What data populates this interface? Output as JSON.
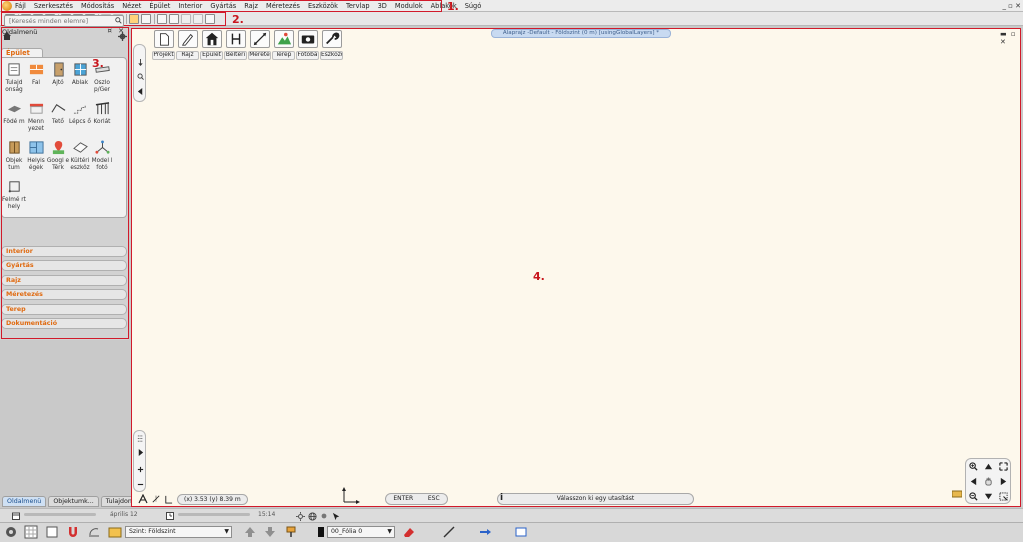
{
  "menu": {
    "items": [
      "Fájl",
      "Szerkesztés",
      "Módosítás",
      "Nézet",
      "Épület",
      "Interior",
      "Gyártás",
      "Rajz",
      "Méretezés",
      "Eszközök",
      "Tervlap",
      "3D",
      "Modulok",
      "Ablakok",
      "Súgó"
    ],
    "window_controls": "_ ▫ ✕"
  },
  "markers": {
    "m1": "1.",
    "m2": "2.",
    "m3": "3.",
    "m4": "4."
  },
  "left_panel": {
    "title": "Oldalmenü",
    "controls": "¤ ✕",
    "search_placeholder": "[Keresés minden elemre]",
    "active_category": "Épület",
    "tools": [
      {
        "label": "Tulajd onság"
      },
      {
        "label": "Fal"
      },
      {
        "label": "Ajtó"
      },
      {
        "label": "Ablak"
      },
      {
        "label": "Oszlo p/Ger"
      },
      {
        "label": "Födé m"
      },
      {
        "label": "Menn yezet"
      },
      {
        "label": "Tető"
      },
      {
        "label": "Lépcs ő"
      },
      {
        "label": "Korlát"
      },
      {
        "label": "Objek tum"
      },
      {
        "label": "Helyis égek"
      },
      {
        "label": "Googl e Térk"
      },
      {
        "label": "Kültéri eszköz"
      },
      {
        "label": "Model l fotó"
      },
      {
        "label": "Felmé rt hely"
      }
    ],
    "categories": [
      "Interior",
      "Gyártás",
      "Rajz",
      "Méretezés",
      "Terep",
      "Dokumentáció"
    ],
    "bottom_tabs": [
      "Oldalmenü",
      "Objektumk...",
      "Tulajdonsá..."
    ]
  },
  "canvas": {
    "title": "Alaprajz -Default - Földszint (0 m) [usingGlobalLayers] *",
    "controls": "▬ ▫ ✕",
    "quick_buttons": [
      "Projekt",
      "Rajz",
      "Épület",
      "Beltéri",
      "Mérete",
      "Terep",
      "Fotóba",
      "Eszközö"
    ],
    "coord_x": "(x) 3.53",
    "coord_y": "(y) 8.39 m",
    "keys": [
      "ENTER",
      "ESC"
    ],
    "prompt": "Válasszon ki egy utasítást",
    "prompt_info": "i"
  },
  "status": {
    "date": "április 12",
    "time": "15:14"
  },
  "bottom": {
    "level": "Szint:  Földszint",
    "layer": "00_Fólia 0"
  },
  "colors": {
    "accent_orange": "#e06a10",
    "highlight_red": "#d11a2a",
    "canvas_bg": "#fdf8ec"
  }
}
